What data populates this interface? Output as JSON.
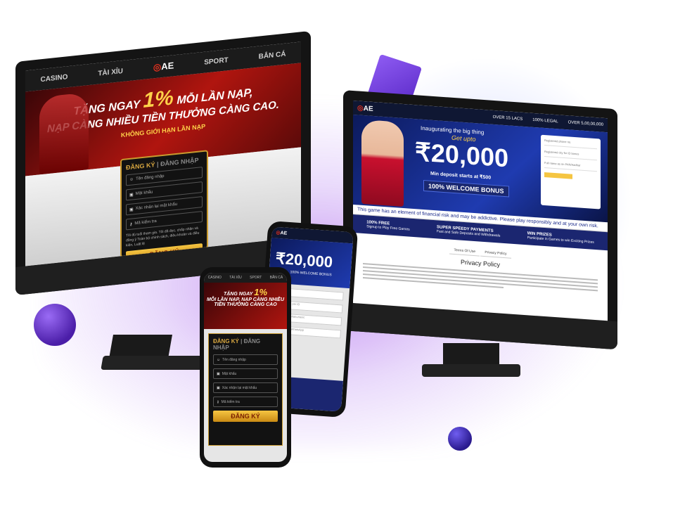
{
  "left_monitor": {
    "nav": [
      "CASINO",
      "TÀI XỈU",
      "AE",
      "SPORT",
      "BẮN CÁ"
    ],
    "banner": {
      "line1_prefix": "TẶNG NGAY",
      "percent": "1%",
      "line1_suffix": "MỖI LẦN NẠP,",
      "line2": "NẠP CÀNG NHIỀU TIỀN THƯỞNG CÀNG CAO.",
      "line3": "KHÔNG GIỚI HẠN LẦN NẠP"
    },
    "form": {
      "tab_register": "ĐĂNG KÝ",
      "tab_login": "ĐĂNG NHẬP",
      "username": "Tên đăng nhập",
      "password": "Mật khẩu",
      "confirm": "Xác nhận lại mật khẩu",
      "captcha": "Mã kiểm tra",
      "terms": "Tôi đủ tuổi tham gia. Tôi đã đọc, chấp nhận và đồng ý Toàn bộ chính sách, điều khoản và điều kiện, Luật lệ",
      "submit": "ĐĂNG KÝ"
    }
  },
  "right_monitor": {
    "logo_text": "AE",
    "stats": [
      "OVER 15 LACS",
      "100% LEGAL",
      "OVER 5,00,00,000"
    ],
    "hero": {
      "kicker": "Inaugurating the big thing",
      "get_upto": "Get upto",
      "amount": "₹20,000",
      "min_deposit": "Min deposit starts at ₹500",
      "bonus": "100% WELCOME BONUS"
    },
    "form_fields": [
      "Registered phone no.",
      "Registered city for ID bonus",
      "Full name as on PAN/Aadhar"
    ],
    "warning": "This game has an element of financial risk and may be addictive. Please play responsibly and at your own risk.",
    "features": [
      {
        "title": "100% FREE",
        "desc": "Signup to Play Free Games"
      },
      {
        "title": "SUPER SPEEDY PAYMENTS",
        "desc": "Fast and Safe Deposits and Withdrawals"
      },
      {
        "title": "WIN PRIZES",
        "desc": "Participate in Games to win Exciting Prizes"
      }
    ],
    "tabs": [
      "Terms Of Use",
      "Privacy Policy"
    ],
    "policy_title": "Privacy Policy"
  },
  "phone_back": {
    "logo_text": "AE",
    "amount": "₹20,000",
    "bonus": "100% WELCOME BONUS",
    "fields": [
      "Phone no",
      "Full name as per ID",
      "e.g. 8 - 20 alphanumeric",
      "Phone No for WhatsApp"
    ]
  },
  "phone_front": {
    "nav": [
      "CASINO",
      "TÀI XỈU",
      "SPORT",
      "BẮN CÁ"
    ],
    "banner_prefix": "TẶNG NGAY",
    "percent": "1%",
    "banner_rest": "MỖI LẦN NẠP, NẠP CÀNG NHIỀU TIỀN THƯỞNG CÀNG CAO",
    "tab_register": "ĐĂNG KÝ",
    "tab_login": "ĐĂNG NHẬP",
    "username": "Tên đăng nhập",
    "password": "Mật khẩu",
    "confirm": "Xác nhận lại mật khẩu",
    "captcha": "Mã kiểm tra",
    "submit": "ĐĂNG KÝ"
  }
}
